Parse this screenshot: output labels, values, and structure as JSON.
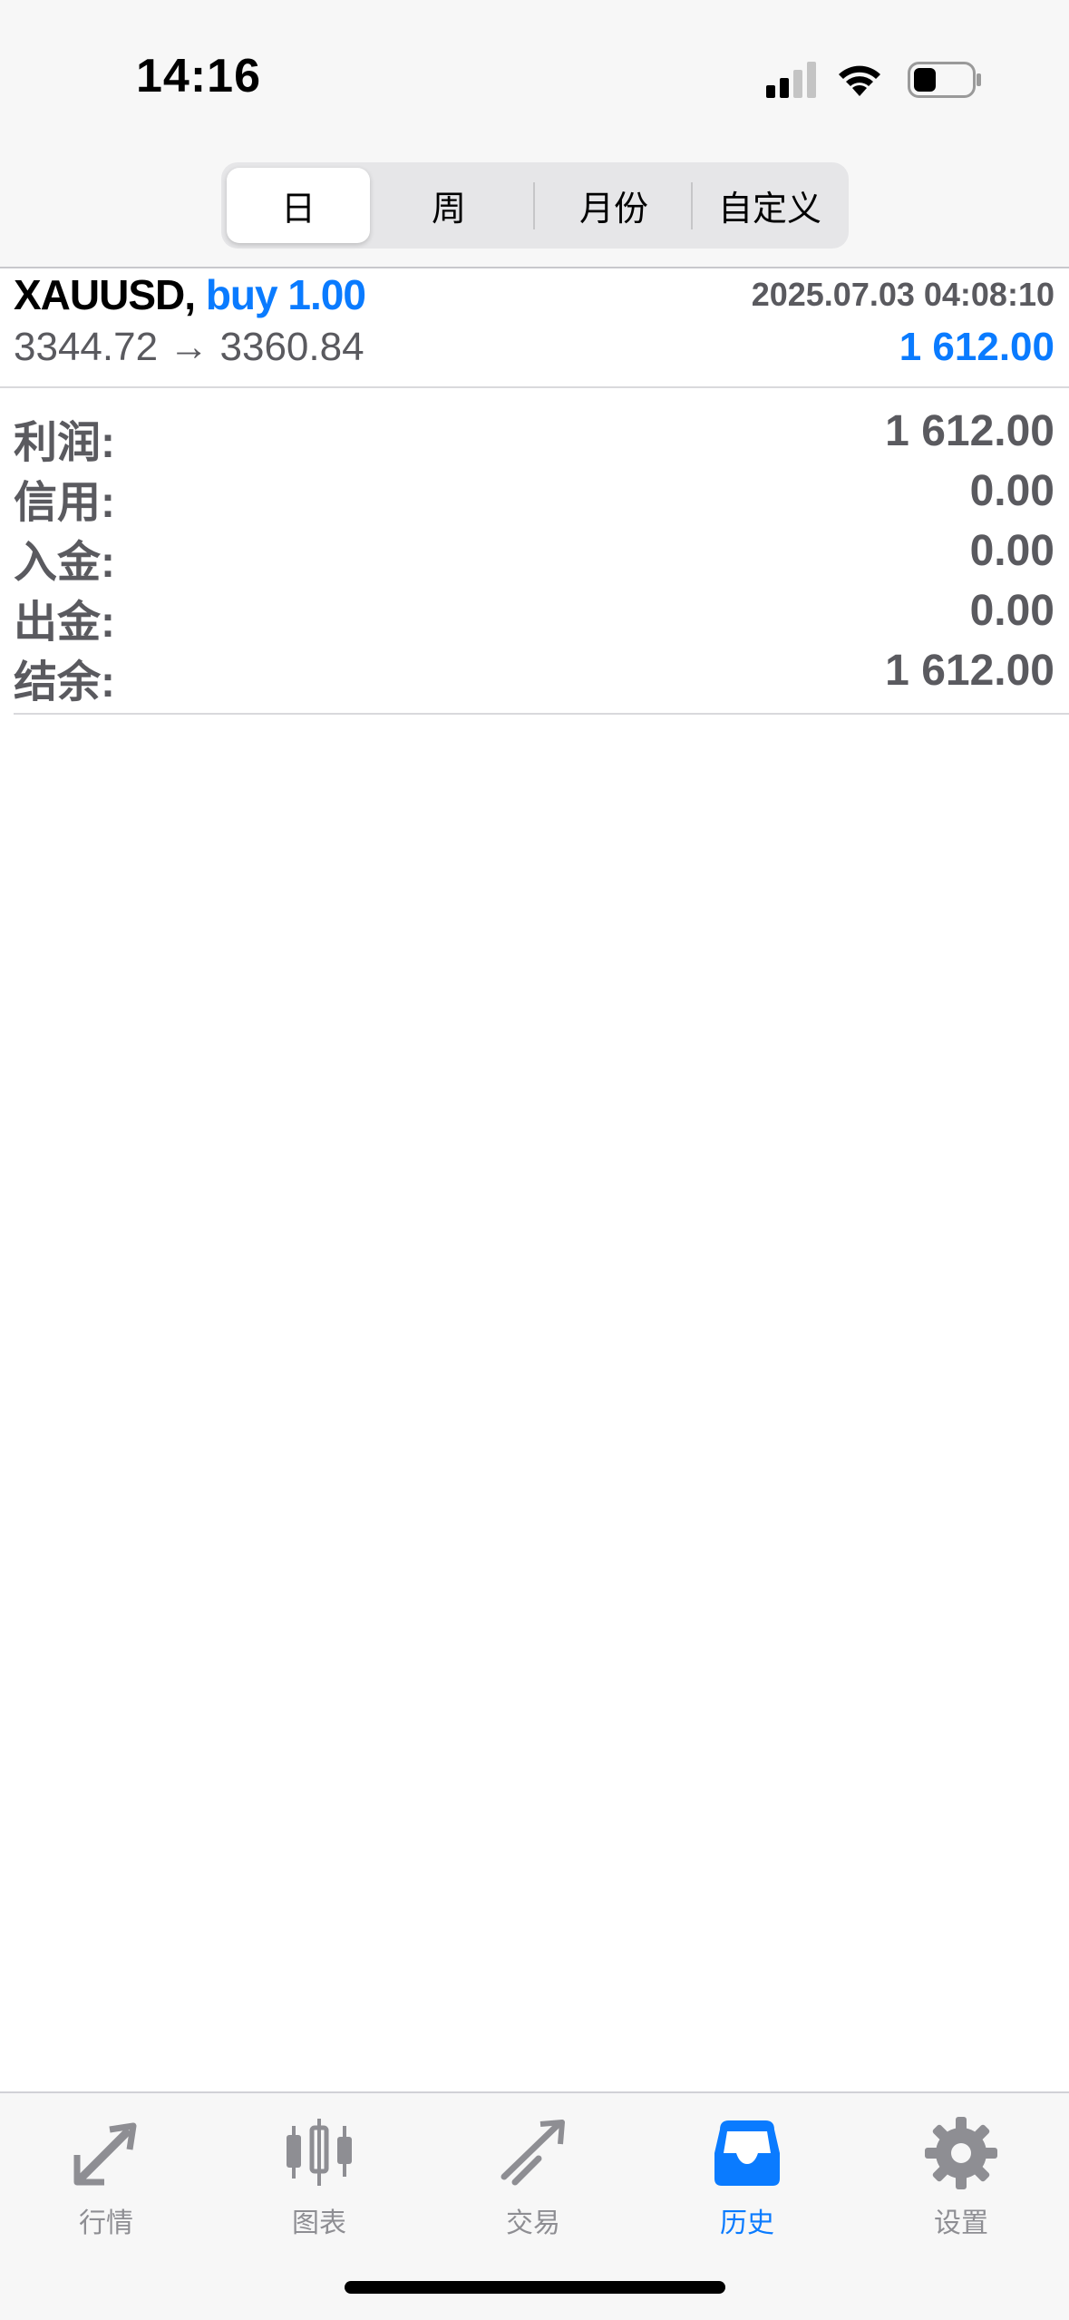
{
  "status_bar": {
    "time": "14:16"
  },
  "segments": [
    {
      "label": "日",
      "active": true
    },
    {
      "label": "周",
      "active": false
    },
    {
      "label": "月份",
      "active": false
    },
    {
      "label": "自定义",
      "active": false
    }
  ],
  "trade": {
    "symbol": "XAUUSD,",
    "side": "buy 1.00",
    "time": "2025.07.03 04:08:10",
    "prices": "3344.72 → 3360.84",
    "profit": "1 612.00"
  },
  "summary": [
    {
      "label": "利润:",
      "value": "1 612.00"
    },
    {
      "label": "信用:",
      "value": "0.00"
    },
    {
      "label": "入金:",
      "value": "0.00"
    },
    {
      "label": "出金:",
      "value": "0.00"
    },
    {
      "label": "结余:",
      "value": "1 612.00"
    }
  ],
  "tabs": [
    {
      "label": "行情",
      "icon": "quotes-icon",
      "active": false
    },
    {
      "label": "图表",
      "icon": "candlestick-chart-icon",
      "active": false
    },
    {
      "label": "交易",
      "icon": "trade-icon",
      "active": false
    },
    {
      "label": "历史",
      "icon": "inbox-history-icon",
      "active": true
    },
    {
      "label": "设置",
      "icon": "gear-icon",
      "active": false
    }
  ],
  "colors": {
    "accent": "#0a7bff",
    "secondary_text": "#5a5a5f",
    "inactive_tab": "#8e8e93"
  }
}
